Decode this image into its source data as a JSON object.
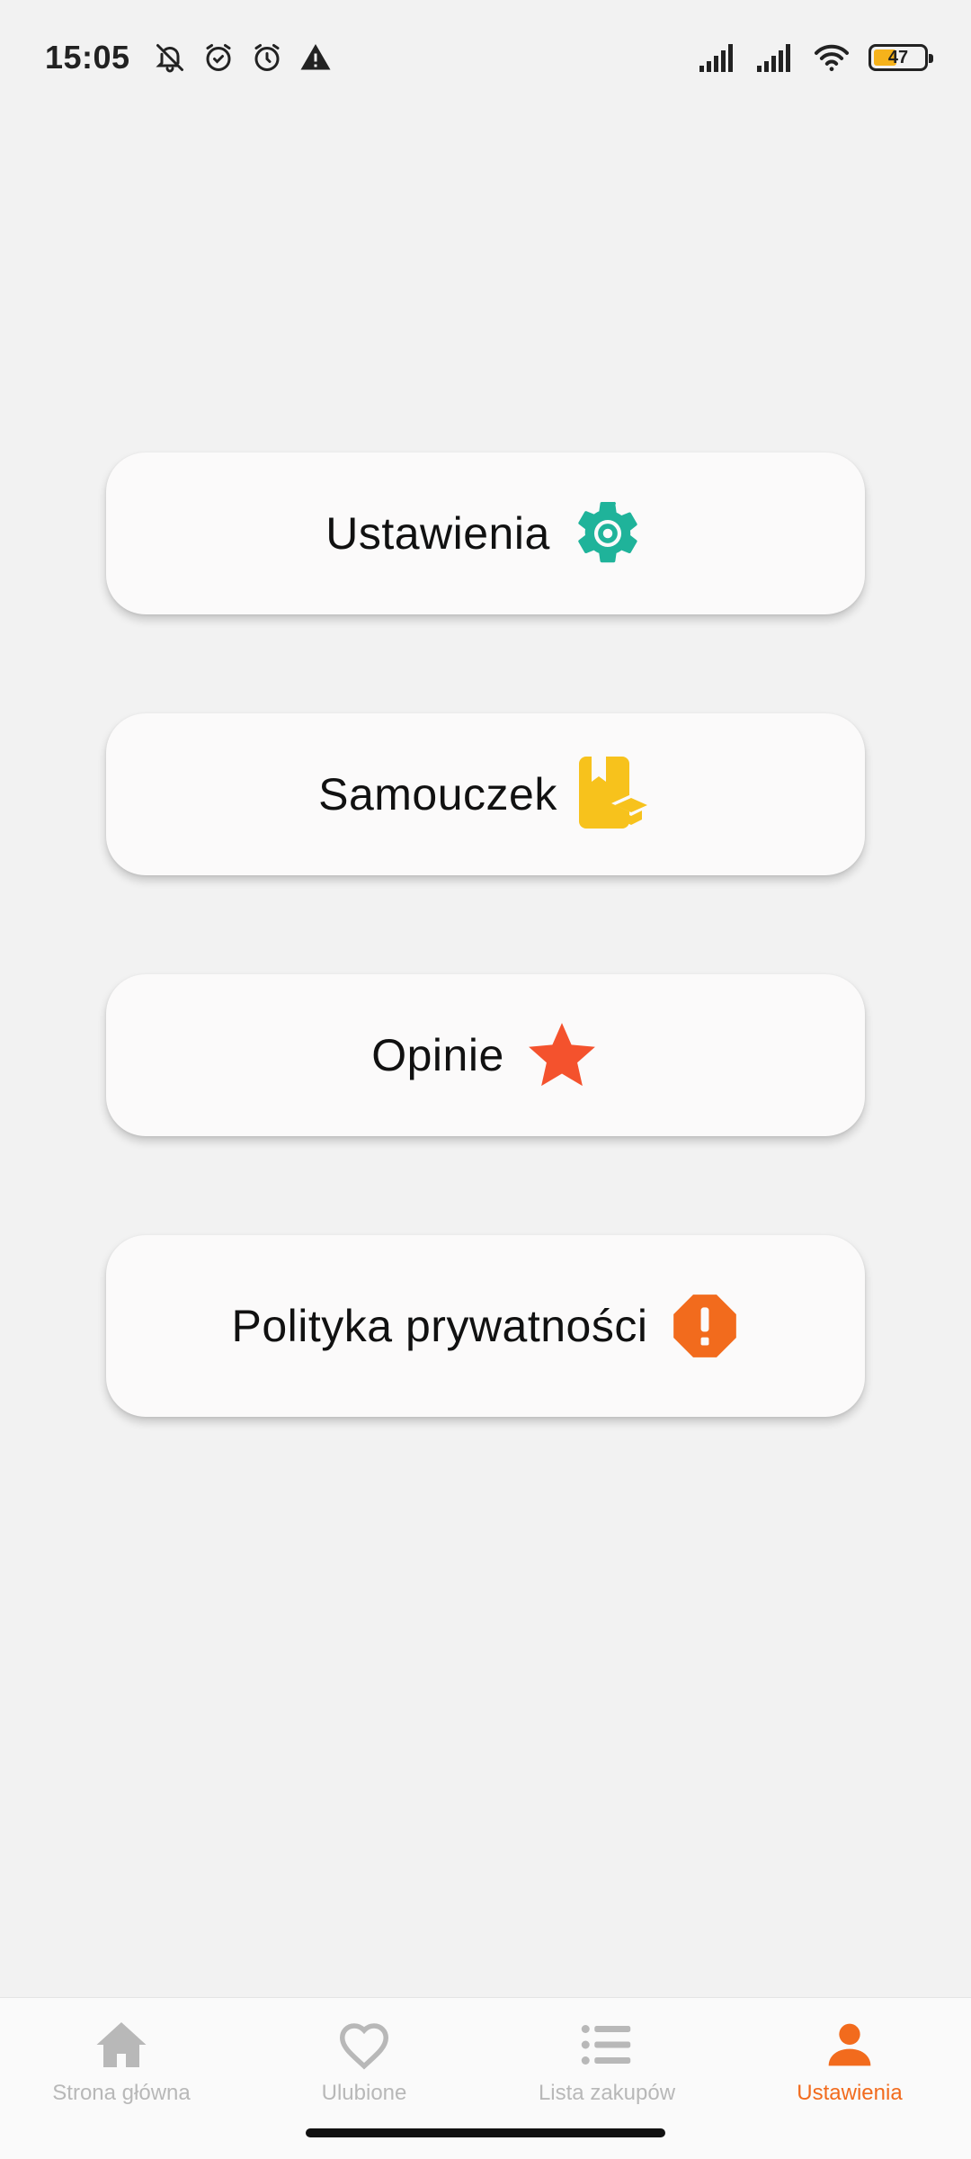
{
  "status_bar": {
    "time": "15:05",
    "battery_level": "47",
    "battery_fraction": 0.47,
    "icons": [
      "bell-off-icon",
      "alarm-icon",
      "alarm-icon",
      "warning-icon",
      "signal-icon",
      "signal-icon",
      "wifi-icon",
      "battery-icon"
    ]
  },
  "menu": {
    "items": [
      {
        "label": "Ustawienia",
        "icon": "gear-icon",
        "color": "#1fb39a"
      },
      {
        "label": "Samouczek",
        "icon": "tutorial-book-icon",
        "color": "#f7c21c"
      },
      {
        "label": "Opinie",
        "icon": "star-icon",
        "color": "#f4522d"
      },
      {
        "label": "Polityka prywatności",
        "icon": "alert-octagon-icon",
        "color": "#f26b1d"
      }
    ]
  },
  "bottom_nav": {
    "items": [
      {
        "label": "Strona główna",
        "icon": "home-icon"
      },
      {
        "label": "Ulubione",
        "icon": "heart-icon"
      },
      {
        "label": "Lista zakupów",
        "icon": "list-icon"
      },
      {
        "label": "Ustawienia",
        "icon": "person-icon",
        "active": true
      }
    ],
    "active_color": "#f26b1d",
    "inactive_color": "#b8b8b8"
  }
}
